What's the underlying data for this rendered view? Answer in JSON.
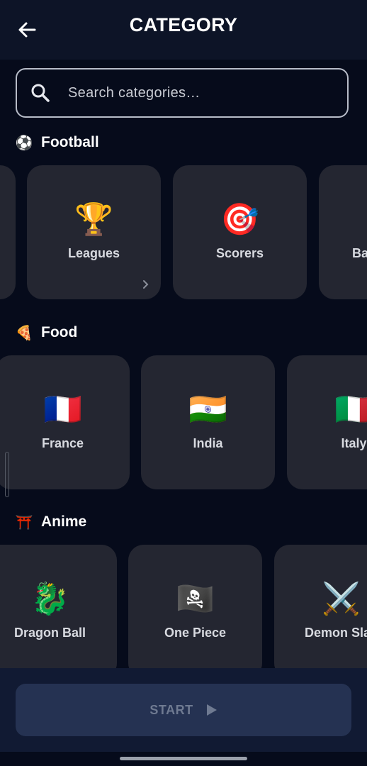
{
  "header": {
    "title": "CATEGORY",
    "back_icon": "arrow-left-icon"
  },
  "search": {
    "placeholder": "Search categories…",
    "icon": "search-icon"
  },
  "sections": [
    {
      "title": "Football",
      "icon": "⚽",
      "cards": [
        {
          "emoji": "🏆",
          "label": "Leagues"
        },
        {
          "emoji": "🎯",
          "label": "Scorers"
        },
        {
          "emoji": "",
          "label": "Ba"
        }
      ]
    },
    {
      "title": "Food",
      "icon": "🍕",
      "cards": [
        {
          "emoji": "🇫🇷",
          "label": "France"
        },
        {
          "emoji": "🇮🇳",
          "label": "India"
        },
        {
          "emoji": "🇮🇹",
          "label": "Italy"
        }
      ]
    },
    {
      "title": "Anime",
      "icon": "⛩️",
      "cards": [
        {
          "emoji": "🐉",
          "label": "Dragon Ball"
        },
        {
          "emoji": "🏴‍☠️",
          "label": "One Piece"
        },
        {
          "emoji": "⚔️",
          "label": "Demon Slay"
        }
      ]
    }
  ],
  "footer": {
    "start_label": "START",
    "start_icon": "play-icon"
  },
  "colors": {
    "background": "#060b1b",
    "card": "#242631",
    "header": "#0d1427",
    "start_button": "#253252"
  }
}
